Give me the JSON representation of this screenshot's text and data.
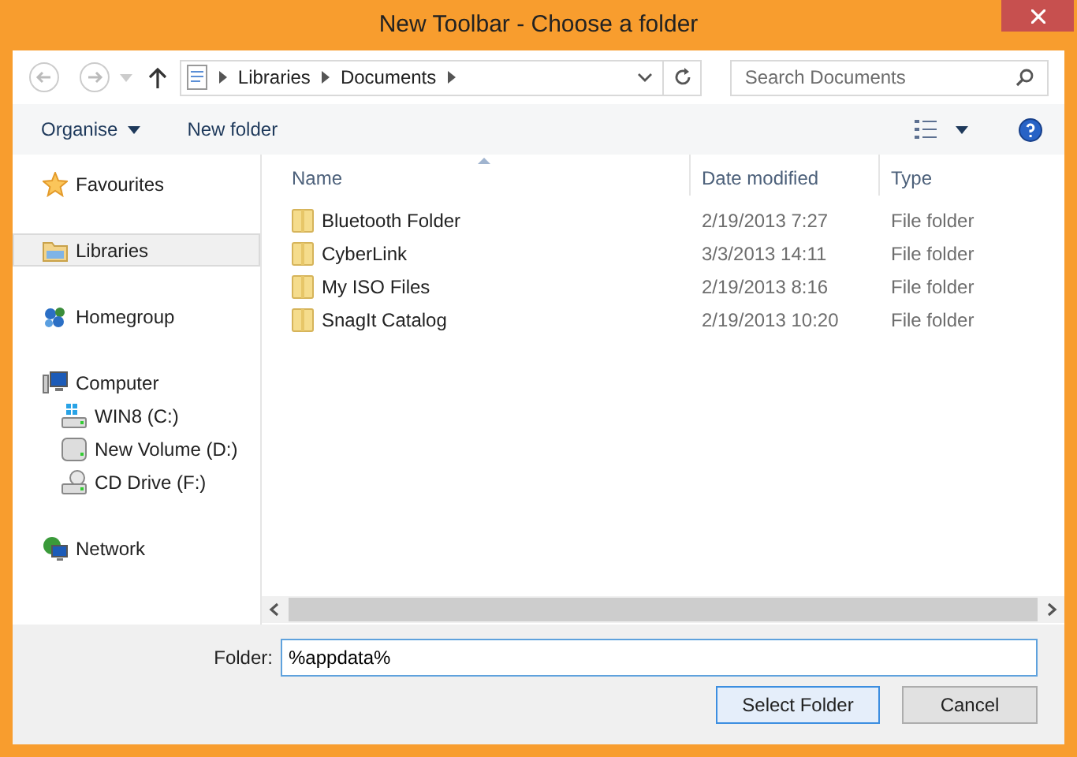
{
  "window": {
    "title": "New Toolbar - Choose a folder"
  },
  "address_bar": {
    "path": [
      "Libraries",
      "Documents"
    ]
  },
  "search": {
    "placeholder": "Search Documents"
  },
  "toolbar": {
    "organise": "Organise",
    "new_folder": "New folder"
  },
  "sidebar": {
    "groups": [
      {
        "label": "Favourites",
        "kind": "star",
        "selected": false
      },
      {
        "label": "Libraries",
        "kind": "library",
        "selected": true
      },
      {
        "label": "Homegroup",
        "kind": "homegroup",
        "selected": false
      },
      {
        "label": "Computer",
        "kind": "computer",
        "selected": false,
        "children": [
          {
            "label": "WIN8 (C:)",
            "kind": "windrive",
            "selected": false
          },
          {
            "label": "New Volume (D:)",
            "kind": "drive",
            "selected": false
          },
          {
            "label": "CD Drive (F:)",
            "kind": "cd",
            "selected": false
          }
        ]
      },
      {
        "label": "Network",
        "kind": "network",
        "selected": false
      }
    ]
  },
  "table": {
    "columns": [
      "Name",
      "Date modified",
      "Type"
    ],
    "rows": [
      {
        "name": "Bluetooth Folder",
        "date": "2/19/2013 7:27",
        "type": "File folder"
      },
      {
        "name": "CyberLink",
        "date": "3/3/2013 14:11",
        "type": "File folder"
      },
      {
        "name": "My ISO Files",
        "date": "2/19/2013 8:16",
        "type": "File folder"
      },
      {
        "name": "SnagIt Catalog",
        "date": "2/19/2013 10:20",
        "type": "File folder"
      }
    ]
  },
  "footer": {
    "folder_label": "Folder:",
    "folder_value": "%appdata%",
    "buttons": [
      {
        "label": "Select Folder",
        "default": true
      },
      {
        "label": "Cancel",
        "default": false
      }
    ]
  }
}
